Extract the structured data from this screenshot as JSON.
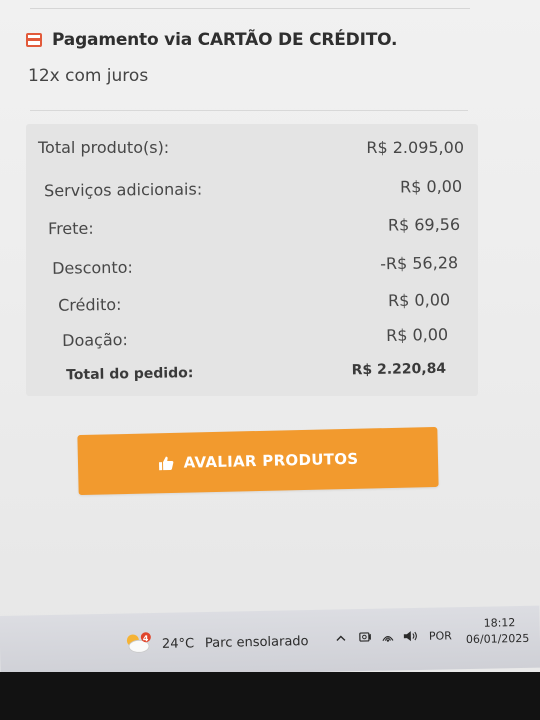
{
  "payment": {
    "title": "Pagamento via CARTÃO DE CRÉDITO.",
    "installments": "12x com juros"
  },
  "summary": {
    "rows": [
      {
        "label": "Total produto(s):",
        "value": "R$ 2.095,00"
      },
      {
        "label": "Serviços adicionais:",
        "value": "R$ 0,00"
      },
      {
        "label": "Frete:",
        "value": "R$ 69,56"
      },
      {
        "label": "Desconto:",
        "value": "-R$ 56,28"
      },
      {
        "label": "Crédito:",
        "value": "R$ 0,00"
      },
      {
        "label": "Doação:",
        "value": "R$ 0,00"
      }
    ],
    "total": {
      "label": "Total do pedido:",
      "value": "R$ 2.220,84"
    }
  },
  "button": {
    "label": "AVALIAR PRODUTOS",
    "icon": "thumbs-up-icon"
  },
  "taskbar": {
    "weather_temp": "24°C",
    "weather_desc": "Parc ensolarado",
    "weather_badge": "4",
    "language": "POR",
    "time": "18:12",
    "date": "06/01/2025"
  },
  "colors": {
    "accent": "#f29a2e",
    "card_icon": "#e25a3a"
  }
}
